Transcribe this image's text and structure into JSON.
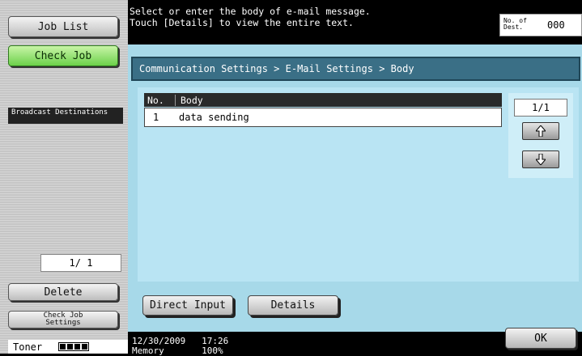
{
  "left": {
    "job_list": "Job List",
    "check_job": "Check Job",
    "broadcast_destinations": "Broadcast Destinations",
    "counter": "1/ 1",
    "delete": "Delete",
    "check_job_settings": "Check Job Settings",
    "toner_label": "Toner"
  },
  "header": {
    "line1": "Select or enter the body of e-mail message.",
    "line2": "Touch [Details] to view the entire text.",
    "dest_label": "No. of Dest.",
    "dest_count": "000"
  },
  "breadcrumb": "Communication Settings > E-Mail Settings > Body",
  "table": {
    "col_no": "No.",
    "col_body": "Body",
    "rows": [
      {
        "no": "1",
        "body": "data sending"
      }
    ]
  },
  "pager": {
    "page": "1/1",
    "up_icon": "arrow-up",
    "down_icon": "arrow-down"
  },
  "buttons": {
    "direct_input": "Direct Input",
    "details": "Details",
    "ok": "OK"
  },
  "status": {
    "datetime": "12/30/2009   17:26",
    "memory": "Memory       100%"
  }
}
